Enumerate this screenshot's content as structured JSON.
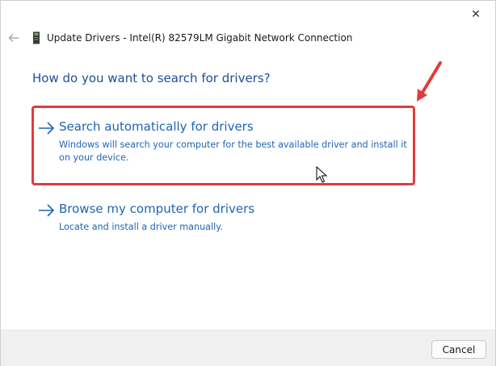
{
  "window": {
    "title": "Update Drivers - Intel(R) 82579LM Gigabit Network Connection",
    "close_symbol": "✕"
  },
  "main": {
    "heading": "How do you want to search for drivers?",
    "options": [
      {
        "title": "Search automatically for drivers",
        "description": "Windows will search your computer for the best available driver and install it on your device."
      },
      {
        "title": "Browse my computer for drivers",
        "description": "Locate and install a driver manually."
      }
    ]
  },
  "footer": {
    "cancel_label": "Cancel"
  },
  "icons": {
    "back": "back-arrow-icon",
    "device": "network-device-icon",
    "option_arrow": "right-arrow-icon",
    "close": "close-icon",
    "annotation_arrow": "red-annotation-arrow",
    "cursor": "mouse-pointer"
  },
  "colors": {
    "heading": "#1f4e99",
    "link": "#1f64b5",
    "highlight": "#e23b3b",
    "footer_bg": "#f0f0f0"
  }
}
